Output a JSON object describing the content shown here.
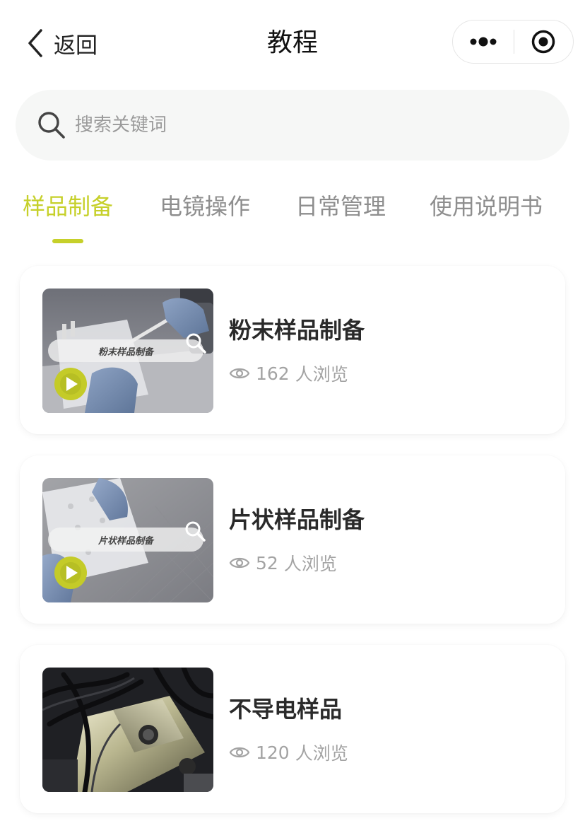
{
  "nav": {
    "back_label": "返回",
    "title": "教程"
  },
  "search": {
    "placeholder": "搜索关键词"
  },
  "tabs": [
    {
      "label": "样品制备",
      "active": true
    },
    {
      "label": "电镜操作",
      "active": false
    },
    {
      "label": "日常管理",
      "active": false
    },
    {
      "label": "使用说明书",
      "active": false
    }
  ],
  "accent_color": "#c6d02a",
  "items": [
    {
      "title": "粉末样品制备",
      "views": "162",
      "views_suffix": "人浏览",
      "thumb_caption": "粉末样品制备"
    },
    {
      "title": "片状样品制备",
      "views": "52",
      "views_suffix": "人浏览",
      "thumb_caption": "片状样品制备"
    },
    {
      "title": "不导电样品",
      "views": "120",
      "views_suffix": "人浏览"
    }
  ]
}
